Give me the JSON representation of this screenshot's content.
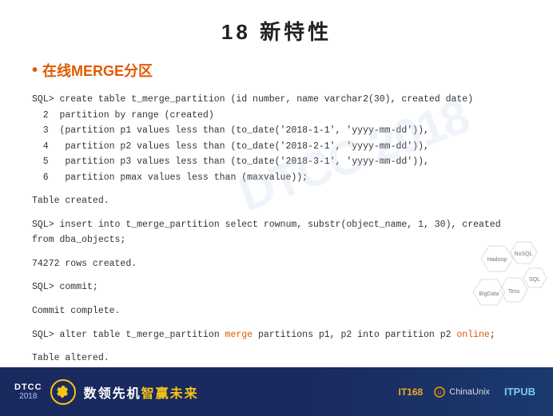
{
  "page": {
    "title": "18  新特性",
    "section": {
      "bullet": "•",
      "heading": "在线MERGE分区"
    },
    "code_blocks": [
      {
        "id": "create_table",
        "lines": [
          "SQL> create table t_merge_partition (id number, name varchar2(30), created date)",
          "  2  partition by range (created)",
          "  3  (partition p1 values less than (to_date('2018-1-1', 'yyyy-mm-dd')),",
          "  4   partition p2 values less than (to_date('2018-2-1', 'yyyy-mm-dd')),",
          "  5   partition p3 values less than (to_date('2018-3-1', 'yyyy-mm-dd')),",
          "  6   partition pmax values less than (maxvalue));"
        ]
      },
      {
        "id": "table_created",
        "lines": [
          "Table created."
        ]
      },
      {
        "id": "insert",
        "lines": [
          "SQL> insert into t_merge_partition select rownum, substr(object_name, 1, 30), created from dba_objects;"
        ]
      },
      {
        "id": "rows_created",
        "lines": [
          "74272 rows created."
        ]
      },
      {
        "id": "commit",
        "lines": [
          "SQL> commit;"
        ]
      },
      {
        "id": "commit_complete",
        "lines": [
          "Commit complete."
        ]
      },
      {
        "id": "alter_table",
        "lines": [
          "SQL> alter table t_merge_partition merge partitions p1, p2 into partition p2 online;"
        ],
        "highlighted": {
          "merge": "merge",
          "online": "online"
        }
      },
      {
        "id": "table_altered",
        "lines": [
          "Table altered."
        ]
      }
    ],
    "watermark": "DTCC 2018",
    "hex_labels": [
      "Hadoop",
      "NoSQL",
      "SQL",
      "BigData",
      "Tess"
    ],
    "footer": {
      "dtcc": "DTCC",
      "year": "2018",
      "slogan_part1": "数领先机",
      "slogan_part2": "智赢未来",
      "logo1": "IT168",
      "logo2": "ChinaUnix",
      "logo3": "ITPUB"
    }
  }
}
